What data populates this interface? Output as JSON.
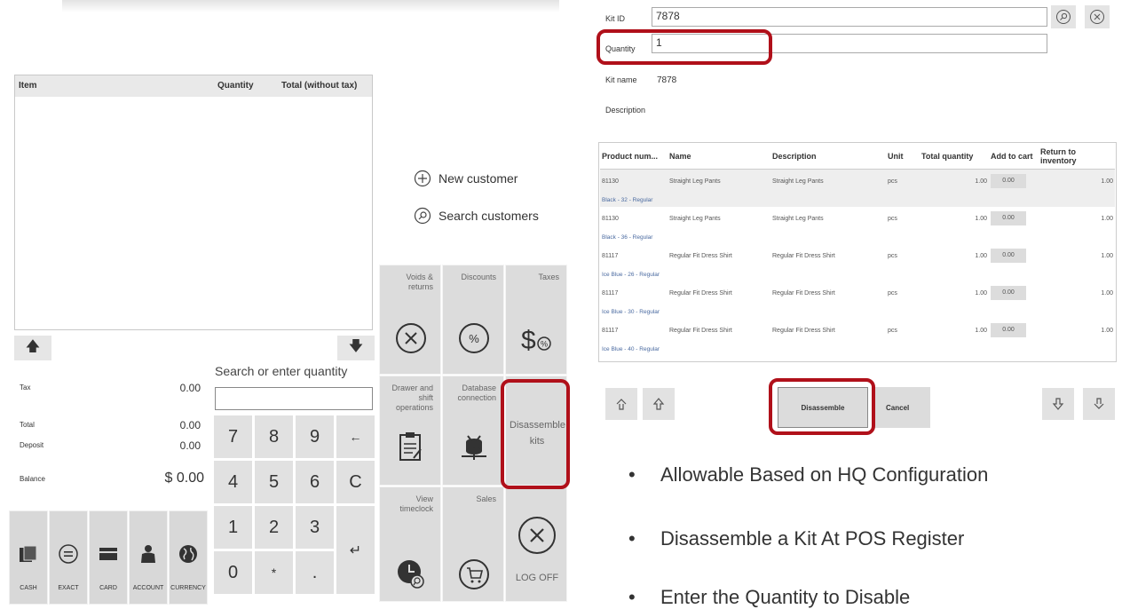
{
  "left_panel": {
    "columns": {
      "item": "Item",
      "quantity": "Quantity",
      "total": "Total (without tax)"
    },
    "totals": {
      "tax_label": "Tax",
      "tax_value": "0.00",
      "total_label": "Total",
      "total_value": "0.00",
      "deposit_label": "Deposit",
      "deposit_value": "0.00",
      "balance_label": "Balance",
      "balance_value": "$ 0.00"
    },
    "search_label": "Search or enter quantity",
    "search_value": "",
    "numpad": [
      "7",
      "8",
      "9",
      "←",
      "4",
      "5",
      "6",
      "C",
      "1",
      "2",
      "3",
      "↵",
      "0",
      "*",
      "."
    ],
    "payments": [
      "CASH",
      "EXACT",
      "CARD",
      "ACCOUNT",
      "CURRENCY"
    ]
  },
  "customer": {
    "new": "New customer",
    "search": "Search customers"
  },
  "tiles": {
    "voids": "Voids & returns",
    "discounts": "Discounts",
    "taxes": "Taxes",
    "drawer": "Drawer and shift operations",
    "database": "Database connection",
    "disassemble": "Disassemble kits",
    "timeclock": "View timeclock",
    "sales": "Sales",
    "logoff": "LOG OFF"
  },
  "kit_form": {
    "kit_id_label": "Kit ID",
    "kit_id_value": "7878",
    "quantity_label": "Quantity",
    "quantity_value": "1",
    "kit_name_label": "Kit name",
    "kit_name_value": "7878",
    "description_label": "Description"
  },
  "kit_table": {
    "headers": [
      "Product num...",
      "Name",
      "Description",
      "Unit",
      "Total quantity",
      "Add to cart",
      "Return to inventory"
    ],
    "rows": [
      {
        "product": "81130",
        "name": "Straight Leg Pants",
        "description": "Straight Leg Pants",
        "unit": "pcs",
        "total": "1.00",
        "cart": "0.00",
        "return": "1.00",
        "variant": "Black - 32 - Regular"
      },
      {
        "product": "81130",
        "name": "Straight Leg Pants",
        "description": "Straight Leg Pants",
        "unit": "pcs",
        "total": "1.00",
        "cart": "0.00",
        "return": "1.00",
        "variant": "Black - 36 - Regular"
      },
      {
        "product": "81117",
        "name": "Regular Fit Dress Shirt",
        "description": "Regular Fit Dress Shirt",
        "unit": "pcs",
        "total": "1.00",
        "cart": "0.00",
        "return": "1.00",
        "variant": "Ice Blue - 26 - Regular"
      },
      {
        "product": "81117",
        "name": "Regular Fit Dress Shirt",
        "description": "Regular Fit Dress Shirt",
        "unit": "pcs",
        "total": "1.00",
        "cart": "0.00",
        "return": "1.00",
        "variant": "Ice Blue - 30 - Regular"
      },
      {
        "product": "81117",
        "name": "Regular Fit Dress Shirt",
        "description": "Regular Fit Dress Shirt",
        "unit": "pcs",
        "total": "1.00",
        "cart": "0.00",
        "return": "1.00",
        "variant": "Ice Blue - 40 - Regular"
      }
    ]
  },
  "actions": {
    "disassemble": "Disassemble",
    "cancel": "Cancel"
  },
  "bullets": [
    "Allowable Based on HQ Configuration",
    "Disassemble a Kit At POS Register",
    "Enter the Quantity to Disable"
  ],
  "colors": {
    "highlight": "#b0101a",
    "tile": "#dcdcdc",
    "key": "#e1e1e1"
  }
}
